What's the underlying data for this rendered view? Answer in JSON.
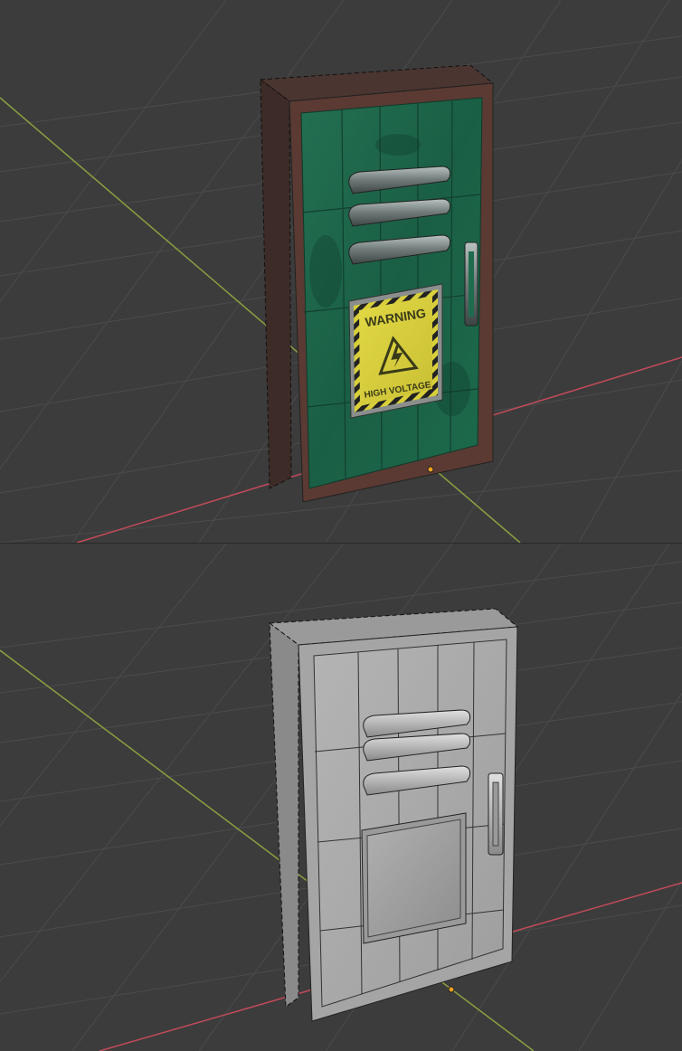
{
  "viewports": [
    {
      "name": "textured-view",
      "shading": "material-preview"
    },
    {
      "name": "solid-view",
      "shading": "solid"
    }
  ],
  "warning_sign": {
    "title": "WARNING",
    "subtitle": "HIGH VOLTAGE"
  },
  "colors": {
    "background": "#3c3c3c",
    "grid": "#4a4a4a",
    "x_axis": "#c24a5a",
    "y_axis": "#8aa040",
    "door_green": "#1f6b4e",
    "frame_brown": "#5a3a32",
    "sign_yellow": "#d8cf3a",
    "solid_gray": "#a9a9a9",
    "origin": "#f0a020"
  }
}
